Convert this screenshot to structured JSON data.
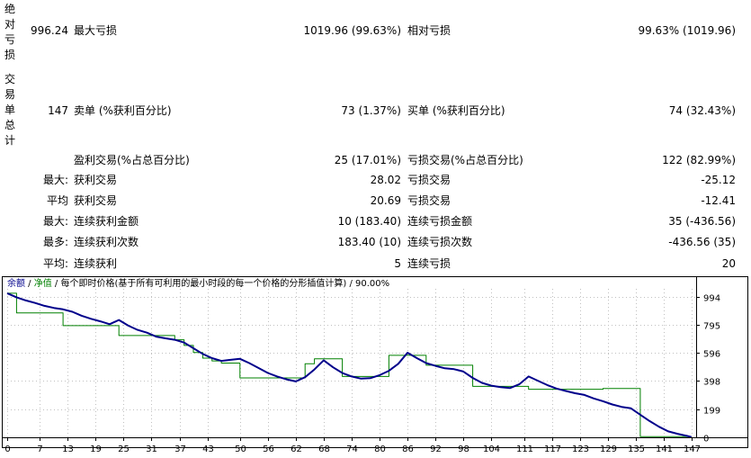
{
  "vertical_labels": {
    "drawdown": [
      "绝",
      "对",
      "亏",
      "损"
    ],
    "trades": [
      "交",
      "易",
      "单",
      "总",
      "计"
    ]
  },
  "rows": {
    "absolute_drawdown_value": "996.24",
    "max_drawdown_label": "最大亏损",
    "max_drawdown_value": "1019.96 (99.63%)",
    "relative_drawdown_label": "相对亏损",
    "relative_drawdown_value": "99.63% (1019.96)",
    "total_trades_value": "147",
    "short_label": "卖单 (%获利百分比)",
    "short_value": "73 (1.37%)",
    "long_label": "买单 (%获利百分比)",
    "long_value": "74 (32.43%)",
    "profit_trades_label": "盈利交易(%占总百分比)",
    "profit_trades_value": "25 (17.01%)",
    "loss_trades_label": "亏损交易(%占总百分比)",
    "loss_trades_value": "122 (82.99%)",
    "largest_prefix": "最大:",
    "largest_profit_label": "获利交易",
    "largest_profit_value": "28.02",
    "largest_loss_label": "亏损交易",
    "largest_loss_value": "-25.12",
    "average_prefix": "平均",
    "average_profit_label": "获利交易",
    "average_profit_value": "20.69",
    "average_loss_label": "亏损交易",
    "average_loss_value": "-12.41",
    "max_consec_prefix": "最大:",
    "max_consec_wins_label": "连续获利金额",
    "max_consec_wins_value": "10 (183.40)",
    "max_consec_losses_label": "连续亏损金额",
    "max_consec_losses_value": "35 (-436.56)",
    "maximal_prefix": "最多:",
    "maximal_consec_profit_label": "连续获利次数",
    "maximal_consec_profit_value": "183.40 (10)",
    "maximal_consec_loss_label": "连续亏损次数",
    "maximal_consec_loss_value": "-436.56 (35)",
    "avg_consec_prefix": "平均:",
    "avg_consec_wins_label": "连续获利",
    "avg_consec_wins_value": "5",
    "avg_consec_losses_label": "连续亏损",
    "avg_consec_losses_value": "20"
  },
  "chart_header": {
    "balance": "余额",
    "sep1": " / ",
    "equity": "净值",
    "sep2": " / ",
    "description": "每个即时价格(基于所有可利用的最小时段的每一个价格的分形插值计算)",
    "sep3": " / ",
    "quality": "90.00%"
  },
  "colors": {
    "balance": "#00008b",
    "equity": "#008000",
    "grid": "#c0c0c0",
    "axis": "#000000"
  },
  "chart_data": {
    "type": "line",
    "xlim": [
      0,
      148
    ],
    "ylim": [
      0,
      1050
    ],
    "x_ticks": [
      0,
      7,
      13,
      19,
      25,
      31,
      37,
      43,
      50,
      56,
      62,
      68,
      74,
      80,
      86,
      92,
      98,
      104,
      111,
      117,
      123,
      129,
      135,
      141,
      147
    ],
    "y_ticks": [
      0,
      199,
      398,
      596,
      795,
      994
    ],
    "series": [
      {
        "name": "余额",
        "x": [
          0,
          2,
          4,
          6,
          8,
          10,
          12,
          14,
          16,
          18,
          20,
          22,
          24,
          26,
          28,
          30,
          32,
          34,
          36,
          38,
          40,
          42,
          44,
          46,
          48,
          50,
          52,
          54,
          56,
          58,
          60,
          62,
          64,
          66,
          68,
          70,
          72,
          74,
          76,
          78,
          80,
          82,
          84,
          86,
          88,
          90,
          92,
          94,
          96,
          98,
          100,
          102,
          104,
          106,
          108,
          110,
          112,
          114,
          116,
          118,
          120,
          122,
          124,
          126,
          128,
          130,
          132,
          134,
          136,
          138,
          140,
          142,
          144,
          146,
          147
        ],
        "values": [
          1019,
          990,
          968,
          950,
          930,
          915,
          905,
          888,
          860,
          838,
          820,
          800,
          830,
          790,
          760,
          740,
          712,
          700,
          690,
          670,
          630,
          590,
          560,
          540,
          548,
          555,
          525,
          490,
          455,
          430,
          410,
          395,
          425,
          480,
          545,
          495,
          455,
          430,
          415,
          418,
          440,
          470,
          520,
          598,
          560,
          525,
          505,
          488,
          482,
          465,
          420,
          385,
          365,
          355,
          348,
          375,
          430,
          400,
          370,
          345,
          328,
          312,
          300,
          275,
          255,
          232,
          215,
          205,
          160,
          115,
          75,
          42,
          25,
          10,
          2
        ]
      },
      {
        "name": "净值",
        "x": [
          0,
          2,
          4,
          6,
          8,
          10,
          12,
          14,
          16,
          18,
          20,
          22,
          24,
          26,
          28,
          30,
          32,
          34,
          36,
          38,
          40,
          42,
          44,
          46,
          48,
          50,
          52,
          54,
          56,
          58,
          60,
          62,
          64,
          66,
          68,
          70,
          72,
          74,
          76,
          78,
          80,
          82,
          84,
          86,
          88,
          90,
          92,
          94,
          96,
          98,
          100,
          102,
          104,
          106,
          108,
          110,
          112,
          114,
          116,
          118,
          120,
          122,
          124,
          126,
          128,
          130,
          132,
          134,
          136,
          138,
          140,
          142,
          144,
          146,
          147
        ],
        "values": [
          1019,
          880,
          880,
          880,
          880,
          880,
          790,
          790,
          790,
          790,
          790,
          790,
          720,
          720,
          720,
          720,
          720,
          720,
          690,
          650,
          600,
          560,
          540,
          525,
          525,
          420,
          420,
          420,
          420,
          420,
          420,
          420,
          520,
          555,
          555,
          555,
          430,
          430,
          430,
          430,
          430,
          580,
          580,
          580,
          580,
          510,
          510,
          510,
          510,
          510,
          360,
          360,
          360,
          360,
          360,
          360,
          340,
          340,
          340,
          340,
          340,
          340,
          340,
          340,
          345,
          345,
          345,
          345,
          5,
          5,
          5,
          5,
          5,
          5,
          5
        ]
      }
    ]
  }
}
